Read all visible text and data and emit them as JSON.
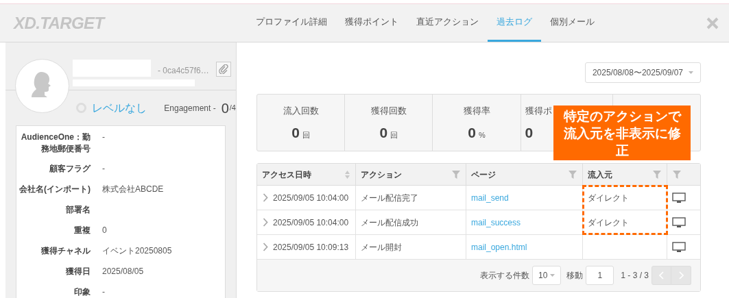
{
  "header": {
    "logo": "XD.TARGET",
    "tabs": [
      {
        "label": "プロファイル詳細",
        "selected": false
      },
      {
        "label": "獲得ポイント",
        "selected": false
      },
      {
        "label": "直近アクション",
        "selected": false
      },
      {
        "label": "過去ログ",
        "selected": true
      },
      {
        "label": "個別メール",
        "selected": false
      }
    ]
  },
  "profile": {
    "id": "- 0ca4c57f6…",
    "level": {
      "label": "レベルなし",
      "selected": false
    },
    "engagement_label": "Engagement -",
    "engagement_value": "0",
    "engagement_total": "/4",
    "fields": [
      {
        "label": "AudienceOne：勤務地郵便番号",
        "value": "-"
      },
      {
        "label": "顧客フラグ",
        "value": "-"
      },
      {
        "label": "会社名(インポート)",
        "value": "株式会社ABCDE"
      },
      {
        "label": "部署名"
      },
      {
        "label": "重複",
        "value": "0"
      },
      {
        "label": "獲得チャネル",
        "value": "イベント20250805"
      },
      {
        "label": "獲得日",
        "value": "2025/08/05"
      },
      {
        "label": "印象",
        "value": "-"
      }
    ]
  },
  "date_range": "2025/08/08〜2025/09/07",
  "stats": [
    {
      "label": "流入回数",
      "value": "0",
      "unit": "回"
    },
    {
      "label": "獲得回数",
      "value": "0",
      "unit": "回"
    },
    {
      "label": "獲得率",
      "value": "0",
      "unit": "%"
    },
    {
      "label": "獲得ポ",
      "value": "0"
    }
  ],
  "table": {
    "columns": [
      {
        "label": "アクセス日時",
        "kind": "sort"
      },
      {
        "label": "アクション",
        "kind": "filter"
      },
      {
        "label": "ページ",
        "kind": "filter"
      },
      {
        "label": "流入元",
        "kind": "filter"
      },
      {
        "kind": "filter"
      }
    ],
    "rows": [
      {
        "datetime": "2025/09/05 10:04:00",
        "action": "メール配信完了",
        "page": "mail_send",
        "source": "ダイレクト"
      },
      {
        "datetime": "2025/09/05 10:04:00",
        "action": "メール配信成功",
        "page": "mail_success",
        "source": "ダイレクト"
      },
      {
        "datetime": "2025/09/05 10:09:13",
        "action": "メール開封",
        "page": "mail_open.html"
      }
    ],
    "footer": {
      "per_page_label": "表示する件数",
      "per_page": "10",
      "goto_label": "移動",
      "goto_value": "1",
      "range": "1 - 3 / 3"
    }
  },
  "annotation": {
    "text": "特定のアクションで流入元を非表示に修正"
  }
}
